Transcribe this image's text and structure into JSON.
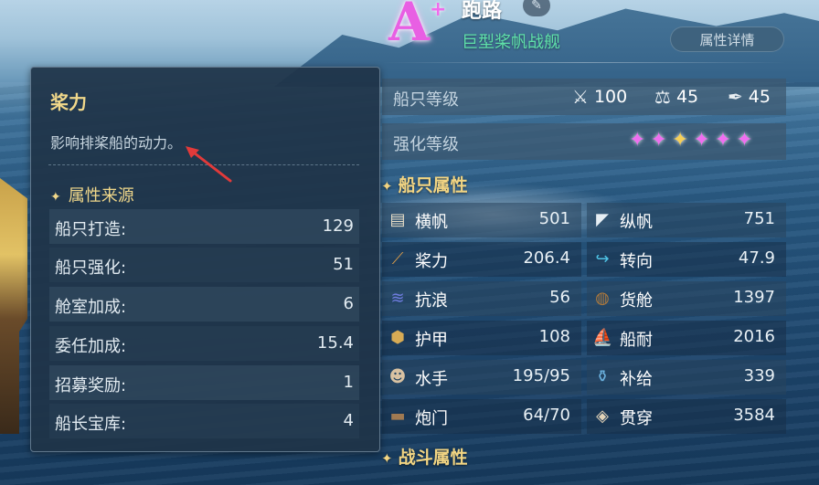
{
  "ship": {
    "grade": "A",
    "grade_plus": "+",
    "name": "跑路",
    "type": "巨型桨帆战舰",
    "detail_button": "属性详情"
  },
  "level": {
    "ship_level_label": "船只等级",
    "stats": [
      {
        "icon": "crossed-swords-icon",
        "value": "100"
      },
      {
        "icon": "scales-icon",
        "value": "45"
      },
      {
        "icon": "quill-icon",
        "value": "45"
      }
    ],
    "enhance_label": "强化等级",
    "stars": [
      "pink",
      "pink",
      "gold",
      "pink",
      "pink",
      "pink"
    ]
  },
  "ship_attrs": {
    "title": "船只属性",
    "items": [
      {
        "icon": "square-sail-icon",
        "label": "横帆",
        "value": "501"
      },
      {
        "icon": "lateen-sail-icon",
        "label": "纵帆",
        "value": "751"
      },
      {
        "icon": "oar-icon",
        "label": "桨力",
        "value": "206.4"
      },
      {
        "icon": "turn-arrow-icon",
        "label": "转向",
        "value": "47.9"
      },
      {
        "icon": "wave-icon",
        "label": "抗浪",
        "value": "56"
      },
      {
        "icon": "barrel-icon",
        "label": "货舱",
        "value": "1397"
      },
      {
        "icon": "armor-plate-icon",
        "label": "护甲",
        "value": "108"
      },
      {
        "icon": "hull-icon",
        "label": "船耐",
        "value": "2016"
      },
      {
        "icon": "sailor-icon",
        "label": "水手",
        "value": "195/95"
      },
      {
        "icon": "supply-icon",
        "label": "补给",
        "value": "339"
      },
      {
        "icon": "cannon-icon",
        "label": "炮门",
        "value": "64/70"
      },
      {
        "icon": "penetrate-icon",
        "label": "贯穿",
        "value": "3584"
      }
    ]
  },
  "battle_attrs": {
    "title": "战斗属性"
  },
  "tooltip": {
    "title": "桨力",
    "description": "影响排桨船的动力。",
    "source_title": "属性来源",
    "rows": [
      {
        "label": "船只打造:",
        "value": "129"
      },
      {
        "label": "船只强化:",
        "value": "51"
      },
      {
        "label": "舱室加成:",
        "value": "6"
      },
      {
        "label": "委任加成:",
        "value": "15.4"
      },
      {
        "label": "招募奖励:",
        "value": "1"
      },
      {
        "label": "船长宝库:",
        "value": "4"
      }
    ]
  },
  "colors": {
    "grade": "#e85fe3",
    "ship_type": "#5fe0a9",
    "gold_text": "#f1d88a",
    "annotation_arrow": "#e23a3a"
  }
}
